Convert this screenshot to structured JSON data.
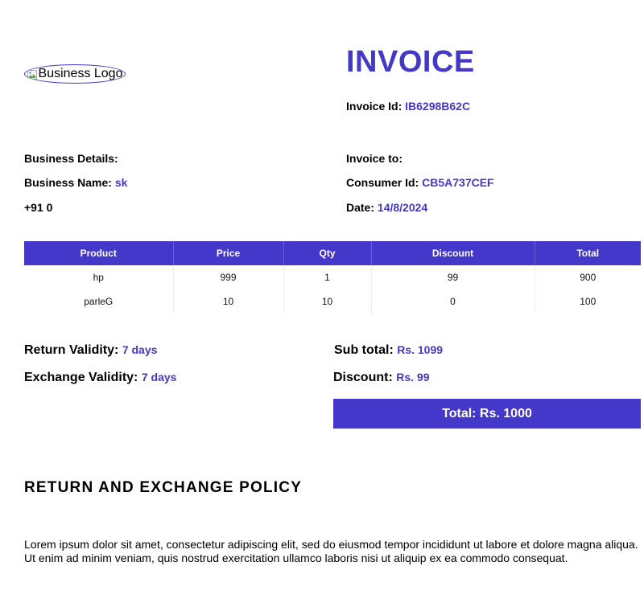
{
  "header": {
    "logo_alt": "Business Logo",
    "title": "INVOICE",
    "invoice_id_label": "Invoice Id:",
    "invoice_id": "IB6298B62C"
  },
  "business": {
    "heading": "Business Details:",
    "name_label": "Business Name:",
    "name": "sk",
    "phone": "+91 0"
  },
  "consumer": {
    "heading": "Invoice to:",
    "id_label": "Consumer Id:",
    "id": "CB5A737CEF",
    "date_label": "Date:",
    "date": "14/8/2024"
  },
  "table": {
    "columns": [
      "Product",
      "Price",
      "Qty",
      "Discount",
      "Total"
    ],
    "rows": [
      [
        "hp",
        "999",
        "1",
        "99",
        "900"
      ],
      [
        "parleG",
        "10",
        "10",
        "0",
        "100"
      ]
    ]
  },
  "validity": {
    "return_label": "Return Validity:",
    "return_value": "7 days",
    "exchange_label": "Exchange Validity:",
    "exchange_value": "7 days"
  },
  "summary": {
    "subtotal_label": "Sub total:",
    "subtotal_value": "Rs. 1099",
    "discount_label": "Discount:",
    "discount_value": "Rs. 99",
    "total_text": "Total: Rs. 1000"
  },
  "policy": {
    "title": "RETURN AND EXCHANGE POLICY",
    "text": "Lorem ipsum dolor sit amet, consectetur adipiscing elit, sed do eiusmod tempor incididunt ut labore et dolore magna aliqua. Ut enim ad minim veniam, quis nostrud exercitation ullamco laboris nisi ut aliquip ex ea commodo consequat."
  },
  "colors": {
    "accent": "#4338ca"
  }
}
